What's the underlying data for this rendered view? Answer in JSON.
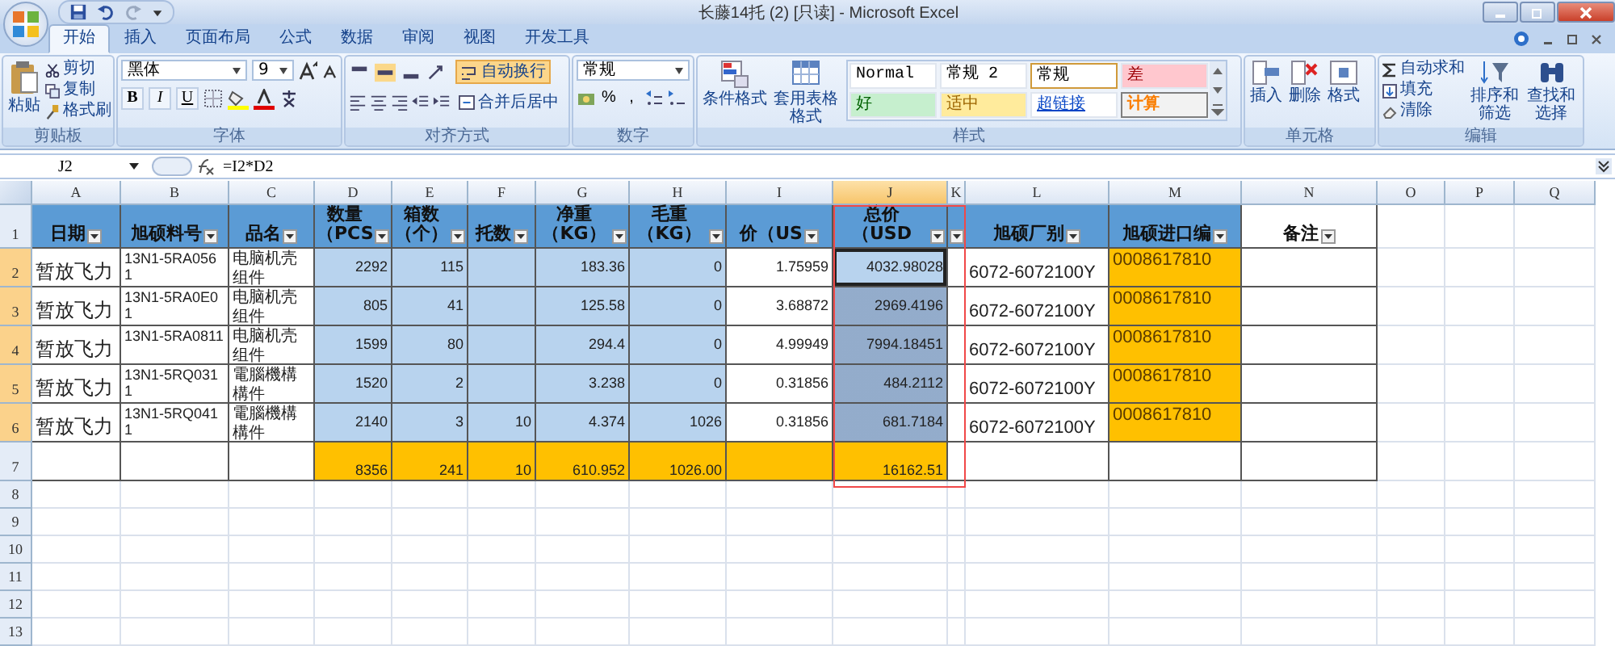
{
  "window": {
    "title": "长藤14托 (2)  [只读] - Microsoft Excel"
  },
  "tabs": [
    {
      "label": "开始",
      "selected": true
    },
    {
      "label": "插入",
      "selected": false
    },
    {
      "label": "页面布局",
      "selected": false
    },
    {
      "label": "公式",
      "selected": false
    },
    {
      "label": "数据",
      "selected": false
    },
    {
      "label": "审阅",
      "selected": false
    },
    {
      "label": "视图",
      "selected": false
    },
    {
      "label": "开发工具",
      "selected": false
    }
  ],
  "ribbon": {
    "clipboard": {
      "label": "剪贴板",
      "paste": "粘贴",
      "actions": [
        "剪切",
        "复制",
        "格式刷"
      ]
    },
    "font": {
      "label": "字体",
      "name": "黑体",
      "size": "9",
      "buttons": [
        "B",
        "I",
        "U"
      ]
    },
    "alignment": {
      "label": "对齐方式",
      "wrap_text": {
        "label": "自动换行",
        "on": true
      },
      "merge": "合并后居中"
    },
    "number": {
      "label": "数字",
      "format": "常规",
      "buttons": [
        "%",
        ","
      ]
    },
    "styles": {
      "label": "样式",
      "commands": [
        "条件格式",
        "套用表格格式"
      ],
      "cells": [
        {
          "label": "Normal",
          "kind": "normal"
        },
        {
          "label": "常规 2",
          "kind": "normal"
        },
        {
          "label": "常规",
          "kind": "current"
        },
        {
          "label": "差",
          "kind": "bad"
        },
        {
          "label": "好",
          "kind": "good"
        },
        {
          "label": "适中",
          "kind": "neutral"
        },
        {
          "label": "超链接",
          "kind": "link"
        },
        {
          "label": "计算",
          "kind": "calc"
        }
      ]
    },
    "cells": {
      "label": "单元格",
      "commands": [
        "插入",
        "删除",
        "格式"
      ]
    },
    "editing": {
      "label": "编辑",
      "actions": [
        "自动求和",
        "填充",
        "清除"
      ],
      "commands": [
        "排序和筛选",
        "查找和选择"
      ]
    }
  },
  "formula_bar": {
    "name_box": "J2",
    "formula": "=I2*D2"
  },
  "sheet": {
    "columns": [
      {
        "label": "A",
        "selected": false,
        "marked": false
      },
      {
        "label": "B",
        "selected": false,
        "marked": false
      },
      {
        "label": "C",
        "selected": false,
        "marked": false
      },
      {
        "label": "D",
        "selected": false,
        "marked": false
      },
      {
        "label": "E",
        "selected": false,
        "marked": false
      },
      {
        "label": "F",
        "selected": false,
        "marked": false
      },
      {
        "label": "G",
        "selected": false,
        "marked": false
      },
      {
        "label": "H",
        "selected": false,
        "marked": false
      },
      {
        "label": "I",
        "selected": false,
        "marked": false
      },
      {
        "label": "J",
        "selected": true,
        "marked": true
      },
      {
        "label": "K",
        "selected": false,
        "marked": true
      },
      {
        "label": "L",
        "selected": false,
        "marked": false
      },
      {
        "label": "M",
        "selected": false,
        "marked": false
      },
      {
        "label": "N",
        "selected": false,
        "marked": false
      },
      {
        "label": "O",
        "selected": false,
        "marked": false
      },
      {
        "label": "P",
        "selected": false,
        "marked": false
      },
      {
        "label": "Q",
        "selected": false,
        "marked": false
      }
    ],
    "rows": [
      {
        "number": "1",
        "selected": false,
        "kind": "header",
        "cells": [
          {
            "text": "日期",
            "kind": "header",
            "filter": true
          },
          {
            "text": "旭硕料号",
            "kind": "header",
            "filter": true
          },
          {
            "text": "品名",
            "kind": "header",
            "filter": true
          },
          {
            "text": "数量（PCS",
            "kind": "header",
            "filter": true
          },
          {
            "text": "箱数（个）",
            "kind": "header",
            "filter": true
          },
          {
            "text": "托数",
            "kind": "header",
            "filter": true
          },
          {
            "text": "净重（KG）",
            "kind": "header",
            "filter": true
          },
          {
            "text": "毛重（KG）",
            "kind": "header",
            "filter": true
          },
          {
            "text": "价（US",
            "kind": "header",
            "filter": true
          },
          {
            "text": "总价（USD",
            "kind": "header",
            "filter": true
          },
          {
            "kind": "header",
            "filter": true
          },
          {
            "text": "旭硕厂别",
            "kind": "header",
            "filter": true
          },
          {
            "text": "旭硕进口编",
            "kind": "header",
            "filter": true
          },
          {
            "text": "备注",
            "kind": "plain",
            "filter": true
          }
        ]
      },
      {
        "number": "2",
        "selected": true,
        "kind": "data",
        "cells": [
          {
            "text": "暂放飞力",
            "kind": "plain",
            "selected": false
          },
          {
            "text": "13N1-5RA0561",
            "kind": "plain",
            "selected": false
          },
          {
            "text": "电脑机壳组件",
            "kind": "plain",
            "selected": false
          },
          {
            "text": "2292",
            "kind": "blue",
            "selected": false
          },
          {
            "text": "115",
            "kind": "blue",
            "selected": false
          },
          {
            "kind": "blue",
            "selected": false
          },
          {
            "text": "183.36",
            "kind": "blue",
            "selected": false
          },
          {
            "text": "0",
            "kind": "blue",
            "selected": false
          },
          {
            "text": "1.75959",
            "kind": "plain",
            "selected": false
          },
          {
            "text": "4032.98028",
            "kind": "blue",
            "selected": true
          },
          {
            "kind": "plain",
            "selected": false
          },
          {
            "text": "6072-6072100Y",
            "kind": "plain",
            "selected": false
          },
          {
            "text": "0008617810",
            "kind": "orange",
            "selected": false
          },
          {
            "kind": "plain",
            "selected": false
          }
        ]
      },
      {
        "number": "3",
        "selected": true,
        "kind": "data",
        "cells": [
          {
            "text": "暂放飞力",
            "kind": "plain",
            "selected": false
          },
          {
            "text": "13N1-5RA0E01",
            "kind": "plain",
            "selected": false
          },
          {
            "text": "电脑机壳组件",
            "kind": "plain",
            "selected": false
          },
          {
            "text": "805",
            "kind": "blue",
            "selected": false
          },
          {
            "text": "41",
            "kind": "blue",
            "selected": false
          },
          {
            "kind": "blue",
            "selected": false
          },
          {
            "text": "125.58",
            "kind": "blue",
            "selected": false
          },
          {
            "text": "0",
            "kind": "blue",
            "selected": false
          },
          {
            "text": "3.68872",
            "kind": "plain",
            "selected": false
          },
          {
            "text": "2969.4196",
            "kind": "blue",
            "selected": true
          },
          {
            "kind": "plain",
            "selected": false
          },
          {
            "text": "6072-6072100Y",
            "kind": "plain",
            "selected": false
          },
          {
            "text": "0008617810",
            "kind": "orange",
            "selected": false
          },
          {
            "kind": "plain",
            "selected": false
          }
        ]
      },
      {
        "number": "4",
        "selected": true,
        "kind": "data",
        "cells": [
          {
            "text": "暂放飞力",
            "kind": "plain",
            "selected": false
          },
          {
            "text": "13N1-5RA0811",
            "kind": "plain",
            "selected": false
          },
          {
            "text": "电脑机壳组件",
            "kind": "plain",
            "selected": false
          },
          {
            "text": "1599",
            "kind": "blue",
            "selected": false
          },
          {
            "text": "80",
            "kind": "blue",
            "selected": false
          },
          {
            "kind": "blue",
            "selected": false
          },
          {
            "text": "294.4",
            "kind": "blue",
            "selected": false
          },
          {
            "text": "0",
            "kind": "blue",
            "selected": false
          },
          {
            "text": "4.99949",
            "kind": "plain",
            "selected": false
          },
          {
            "text": "7994.18451",
            "kind": "blue",
            "selected": true
          },
          {
            "kind": "plain",
            "selected": false
          },
          {
            "text": "6072-6072100Y",
            "kind": "plain",
            "selected": false
          },
          {
            "text": "0008617810",
            "kind": "orange",
            "selected": false
          },
          {
            "kind": "plain",
            "selected": false
          }
        ]
      },
      {
        "number": "5",
        "selected": true,
        "kind": "data",
        "cells": [
          {
            "text": "暂放飞力",
            "kind": "plain",
            "selected": false
          },
          {
            "text": "13N1-5RQ0311",
            "kind": "plain",
            "selected": false
          },
          {
            "text": "電腦機構構件",
            "kind": "plain",
            "selected": false
          },
          {
            "text": "1520",
            "kind": "blue",
            "selected": false
          },
          {
            "text": "2",
            "kind": "blue",
            "selected": false
          },
          {
            "kind": "blue",
            "selected": false
          },
          {
            "text": "3.238",
            "kind": "blue",
            "selected": false
          },
          {
            "text": "0",
            "kind": "blue",
            "selected": false
          },
          {
            "text": "0.31856",
            "kind": "plain",
            "selected": false
          },
          {
            "text": "484.2112",
            "kind": "blue",
            "selected": true
          },
          {
            "kind": "plain",
            "selected": false
          },
          {
            "text": "6072-6072100Y",
            "kind": "plain",
            "selected": false
          },
          {
            "text": "0008617810",
            "kind": "orange",
            "selected": false
          },
          {
            "kind": "plain",
            "selected": false
          }
        ]
      },
      {
        "number": "6",
        "selected": true,
        "kind": "data",
        "cells": [
          {
            "text": "暂放飞力",
            "kind": "plain",
            "selected": false
          },
          {
            "text": "13N1-5RQ0411",
            "kind": "plain",
            "selected": false
          },
          {
            "text": "電腦機構構件",
            "kind": "plain",
            "selected": false
          },
          {
            "text": "2140",
            "kind": "blue",
            "selected": false
          },
          {
            "text": "3",
            "kind": "blue",
            "selected": false
          },
          {
            "text": "10",
            "kind": "blue",
            "selected": false
          },
          {
            "text": "4.374",
            "kind": "blue",
            "selected": false
          },
          {
            "text": "1026",
            "kind": "blue",
            "selected": false
          },
          {
            "text": "0.31856",
            "kind": "plain",
            "selected": false
          },
          {
            "text": "681.7184",
            "kind": "blue",
            "selected": true
          },
          {
            "kind": "plain",
            "selected": false
          },
          {
            "text": "6072-6072100Y",
            "kind": "plain",
            "selected": false
          },
          {
            "text": "0008617810",
            "kind": "orange",
            "selected": false
          },
          {
            "kind": "plain",
            "selected": false
          }
        ]
      },
      {
        "number": "7",
        "selected": false,
        "kind": "total",
        "cells": [
          {
            "kind": "plain",
            "selected": false
          },
          {
            "kind": "plain",
            "selected": false
          },
          {
            "kind": "plain",
            "selected": false
          },
          {
            "text": "8356",
            "kind": "orange",
            "selected": false
          },
          {
            "text": "241",
            "kind": "orange",
            "selected": false
          },
          {
            "text": "10",
            "kind": "orange",
            "selected": false
          },
          {
            "text": "610.952",
            "kind": "orange",
            "selected": false
          },
          {
            "text": "1026.00",
            "kind": "orange",
            "selected": false
          },
          {
            "kind": "orange",
            "selected": false
          },
          {
            "text": "16162.51",
            "kind": "orange",
            "selected": false
          },
          {
            "kind": "plain",
            "selected": false
          },
          {
            "kind": "plain",
            "selected": false
          },
          {
            "kind": "plain",
            "selected": false
          },
          {
            "kind": "plain",
            "selected": false
          }
        ]
      }
    ],
    "empty_rows": [
      "8",
      "9",
      "10",
      "11",
      "12",
      "13"
    ]
  }
}
